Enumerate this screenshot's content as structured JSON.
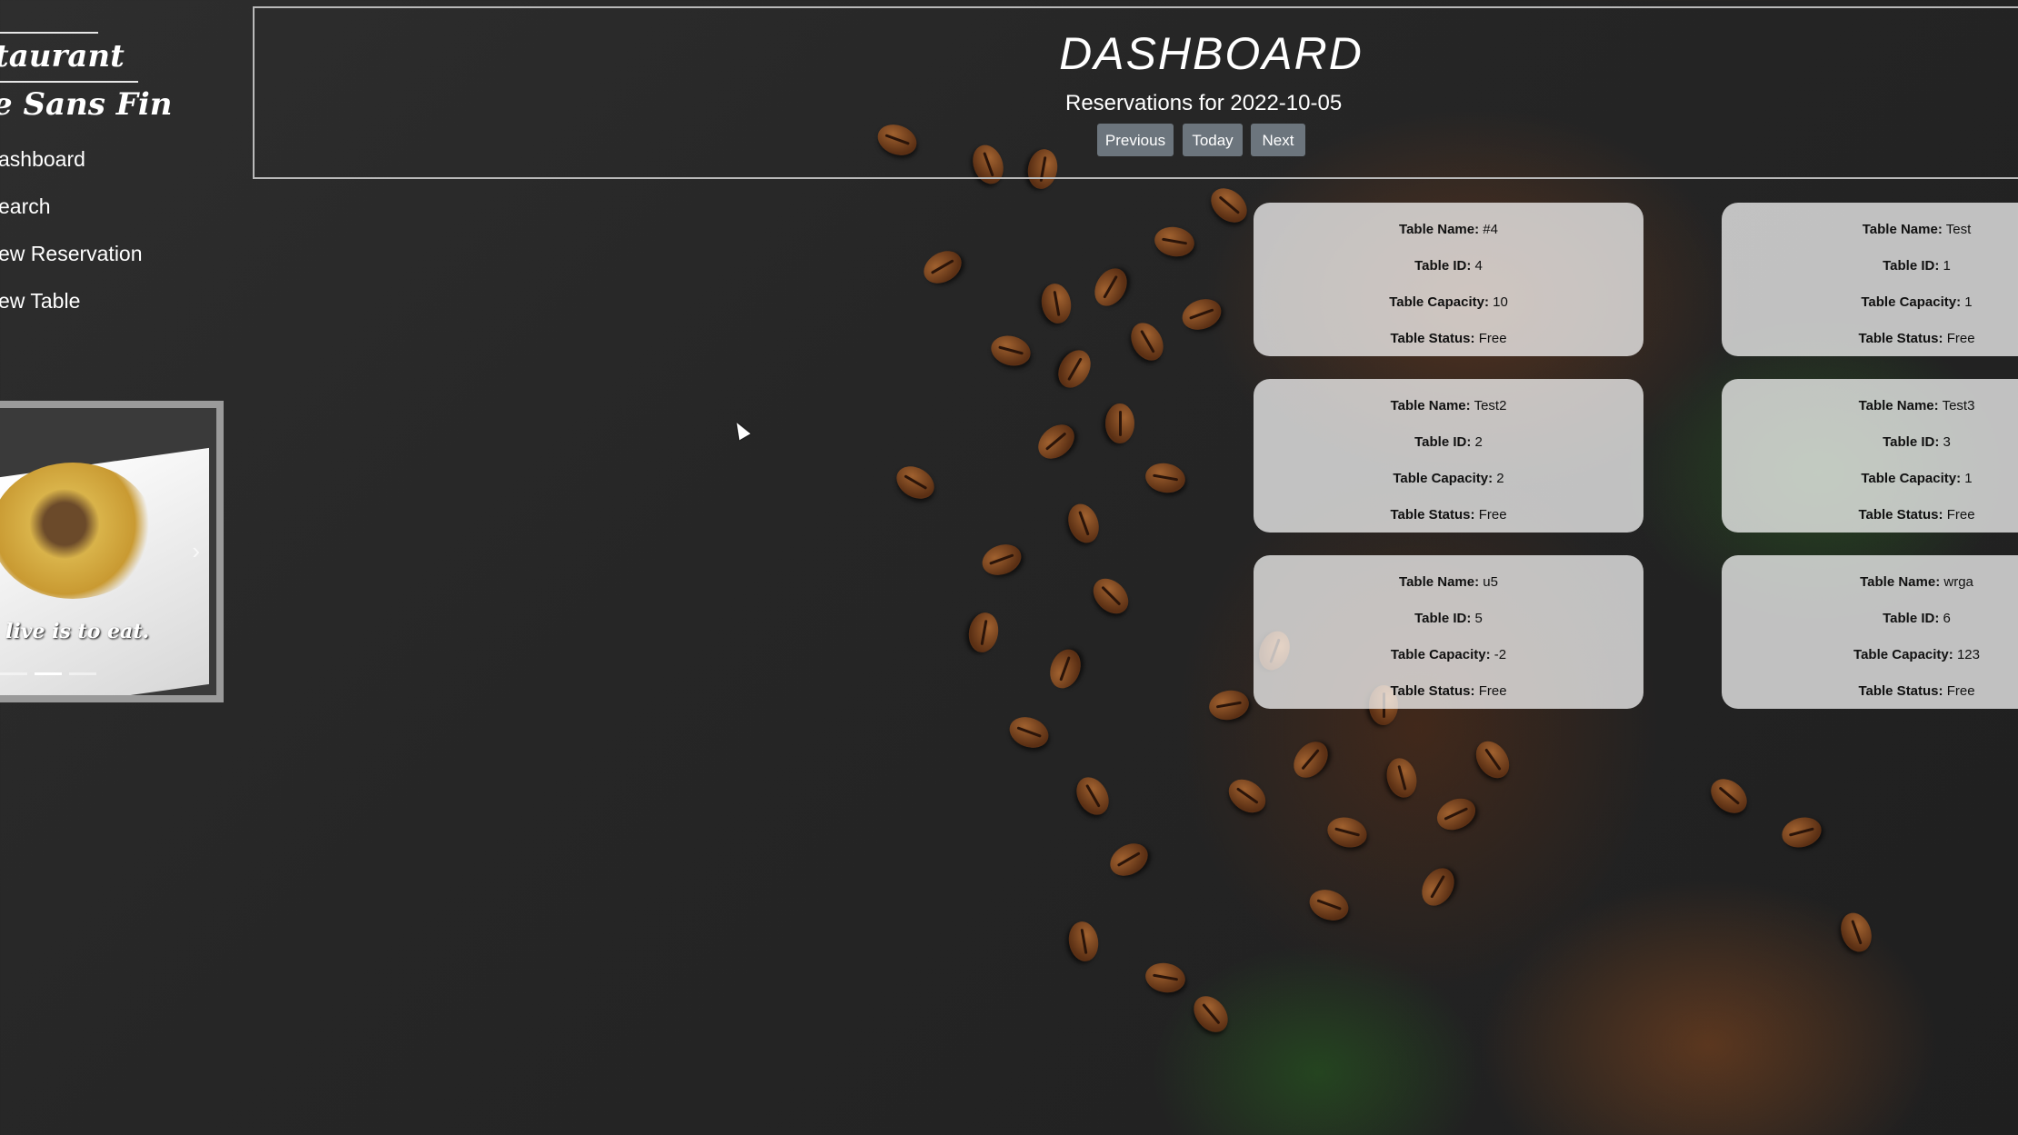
{
  "brand": {
    "line1": "taurant",
    "line2": "e Sans Fin"
  },
  "nav": [
    {
      "label": "ashboard"
    },
    {
      "label": "earch"
    },
    {
      "label": "ew Reservation"
    },
    {
      "label": "ew Table"
    }
  ],
  "carousel": {
    "caption": "live is to eat.",
    "next_glyph": "›",
    "active_index": 1,
    "indicator_count": 3
  },
  "header": {
    "title": "DASHBOARD",
    "subtitle": "Reservations for 2022-10-05",
    "buttons": {
      "previous": "Previous",
      "today": "Today",
      "next": "Next"
    }
  },
  "labels": {
    "name": "Table Name:",
    "id": "Table ID:",
    "capacity": "Table Capacity:",
    "status": "Table Status:"
  },
  "tables": [
    {
      "name": "#4",
      "id": "4",
      "capacity": "10",
      "status": "Free"
    },
    {
      "name": "Test",
      "id": "1",
      "capacity": "1",
      "status": "Free"
    },
    {
      "name": "Test2",
      "id": "2",
      "capacity": "2",
      "status": "Free"
    },
    {
      "name": "Test3",
      "id": "3",
      "capacity": "1",
      "status": "Free"
    },
    {
      "name": "u5",
      "id": "5",
      "capacity": "-2",
      "status": "Free"
    },
    {
      "name": "wrga",
      "id": "6",
      "capacity": "123",
      "status": "Free"
    }
  ],
  "colors": {
    "button_bg": "#6c757d",
    "header_border": "#b9b9b9",
    "card_bg": "rgba(255,255,255,0.72)"
  }
}
